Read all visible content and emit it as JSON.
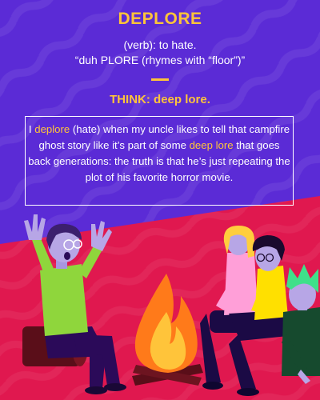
{
  "card": {
    "word": "DEPLORE",
    "part_of_speech": "(verb): to hate.",
    "pronunciation": "“duh PLORE (rhymes with “floor”)”",
    "mnemonic": "THINK: deep lore.",
    "sentence": {
      "s1": "I ",
      "w1": "deplore",
      "s2": " (hate) when my uncle likes to tell that campfire ghost story like it’s part of some ",
      "w2": "deep lore",
      "s3": " that goes back generations: the truth is that he’s just repeating the plot of his favorite horror movie."
    }
  },
  "colors": {
    "purple": "#5b2bd6",
    "red": "#e0184f",
    "yellow": "#ffc43a"
  },
  "illustration": {
    "scene": "campfire-story",
    "icons": [
      "storyteller-icon",
      "campfire-icon",
      "listener-icon"
    ]
  }
}
